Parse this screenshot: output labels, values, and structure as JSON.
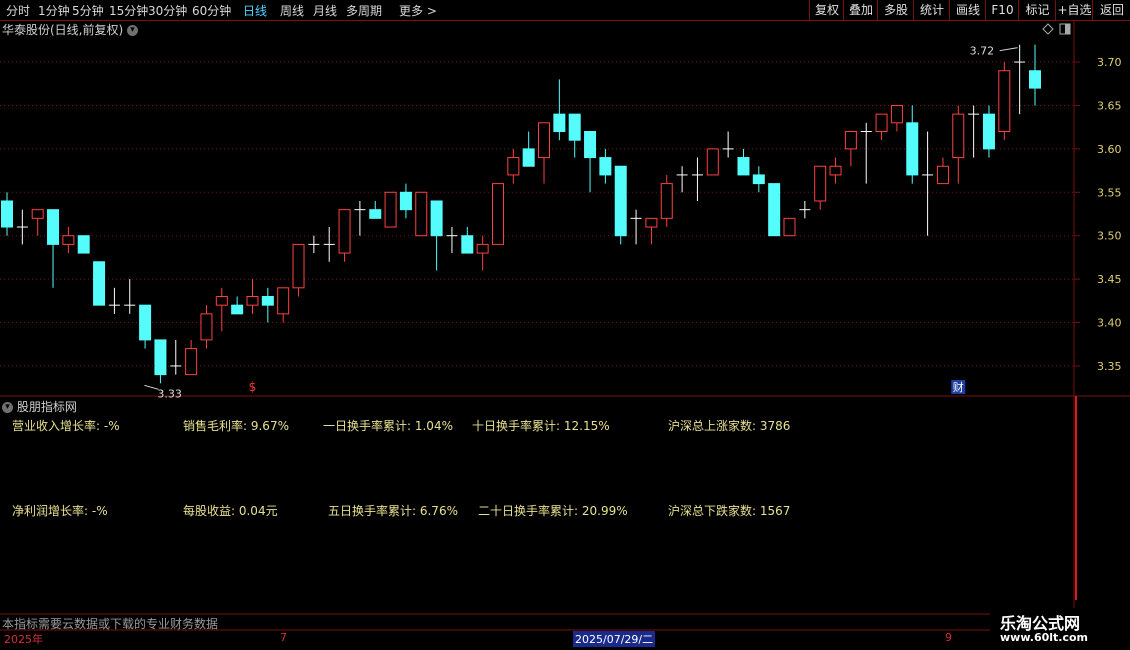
{
  "toolbar": {
    "periods": [
      "分时",
      "1分钟",
      "5分钟",
      "15分钟",
      "30分钟",
      "60分钟",
      "日线",
      "周线",
      "月线",
      "多周期",
      "更多 >"
    ],
    "active_period": "日线",
    "right_buttons": [
      "复权",
      "叠加",
      "多股",
      "统计",
      "画线",
      "F10",
      "标记",
      "+自选",
      "返回"
    ]
  },
  "stock_label": "华泰股份(日线,前复权)",
  "indicator_label": "股朋指标网",
  "indicators": [
    {
      "label": "营业收入增长率: -%"
    },
    {
      "label": "销售毛利率: 9.67%"
    },
    {
      "label": "一日换手率累计: 1.04%"
    },
    {
      "label": "十日换手率累计: 12.15%"
    },
    {
      "label": "沪深总上涨家数: 3786"
    },
    {
      "label": "净利润增长率: -%"
    },
    {
      "label": "每股收益: 0.04元"
    },
    {
      "label": "五日换手率累计: 6.76%"
    },
    {
      "label": "二十日换手率累计: 20.99%"
    },
    {
      "label": "沪深总下跌家数: 1567"
    }
  ],
  "note": "本指标需要云数据或下载的专业财务数据",
  "date_axis": {
    "labels": [
      "2025年",
      "7",
      "9"
    ],
    "selected": "2025/07/29/二"
  },
  "watermark": {
    "title": "乐淘公式网",
    "url": "www.60lt.com"
  },
  "colors": {
    "up": "#ff4040",
    "down": "#54fcfc",
    "doji": "#ffffff",
    "grid": "#7a1010",
    "axis_text": "#e0d070"
  },
  "chart_data": {
    "type": "candlestick",
    "ylim": [
      3.32,
      3.73
    ],
    "yticks": [
      3.35,
      3.4,
      3.45,
      3.5,
      3.55,
      3.6,
      3.65,
      3.7
    ],
    "annotations": [
      {
        "text": "3.72",
        "at_index": 66,
        "kind": "high"
      },
      {
        "text": "3.33",
        "at_index": 10,
        "kind": "low"
      },
      {
        "text": "$",
        "at_index": 16,
        "kind": "marker"
      },
      {
        "text": "财",
        "at_index": 62,
        "kind": "marker"
      }
    ],
    "candles": [
      {
        "o": 3.54,
        "h": 3.55,
        "l": 3.5,
        "c": 3.51
      },
      {
        "o": 3.51,
        "h": 3.53,
        "l": 3.49,
        "c": 3.51
      },
      {
        "o": 3.52,
        "h": 3.53,
        "l": 3.5,
        "c": 3.53
      },
      {
        "o": 3.53,
        "h": 3.53,
        "l": 3.44,
        "c": 3.49
      },
      {
        "o": 3.49,
        "h": 3.51,
        "l": 3.48,
        "c": 3.5
      },
      {
        "o": 3.5,
        "h": 3.5,
        "l": 3.48,
        "c": 3.48
      },
      {
        "o": 3.47,
        "h": 3.47,
        "l": 3.42,
        "c": 3.42
      },
      {
        "o": 3.42,
        "h": 3.44,
        "l": 3.41,
        "c": 3.42
      },
      {
        "o": 3.42,
        "h": 3.45,
        "l": 3.41,
        "c": 3.42
      },
      {
        "o": 3.42,
        "h": 3.42,
        "l": 3.37,
        "c": 3.38
      },
      {
        "o": 3.38,
        "h": 3.38,
        "l": 3.33,
        "c": 3.34
      },
      {
        "o": 3.35,
        "h": 3.38,
        "l": 3.34,
        "c": 3.35
      },
      {
        "o": 3.34,
        "h": 3.38,
        "l": 3.34,
        "c": 3.37
      },
      {
        "o": 3.38,
        "h": 3.42,
        "l": 3.37,
        "c": 3.41
      },
      {
        "o": 3.42,
        "h": 3.44,
        "l": 3.39,
        "c": 3.43
      },
      {
        "o": 3.42,
        "h": 3.43,
        "l": 3.41,
        "c": 3.41
      },
      {
        "o": 3.42,
        "h": 3.45,
        "l": 3.41,
        "c": 3.43
      },
      {
        "o": 3.43,
        "h": 3.44,
        "l": 3.4,
        "c": 3.42
      },
      {
        "o": 3.41,
        "h": 3.44,
        "l": 3.4,
        "c": 3.44
      },
      {
        "o": 3.44,
        "h": 3.49,
        "l": 3.43,
        "c": 3.49
      },
      {
        "o": 3.49,
        "h": 3.5,
        "l": 3.48,
        "c": 3.49
      },
      {
        "o": 3.49,
        "h": 3.51,
        "l": 3.47,
        "c": 3.49
      },
      {
        "o": 3.48,
        "h": 3.53,
        "l": 3.47,
        "c": 3.53
      },
      {
        "o": 3.53,
        "h": 3.54,
        "l": 3.5,
        "c": 3.53
      },
      {
        "o": 3.53,
        "h": 3.54,
        "l": 3.52,
        "c": 3.52
      },
      {
        "o": 3.51,
        "h": 3.55,
        "l": 3.51,
        "c": 3.55
      },
      {
        "o": 3.55,
        "h": 3.56,
        "l": 3.52,
        "c": 3.53
      },
      {
        "o": 3.5,
        "h": 3.55,
        "l": 3.5,
        "c": 3.55
      },
      {
        "o": 3.54,
        "h": 3.54,
        "l": 3.46,
        "c": 3.5
      },
      {
        "o": 3.5,
        "h": 3.51,
        "l": 3.48,
        "c": 3.5
      },
      {
        "o": 3.5,
        "h": 3.51,
        "l": 3.48,
        "c": 3.48
      },
      {
        "o": 3.48,
        "h": 3.5,
        "l": 3.46,
        "c": 3.49
      },
      {
        "o": 3.49,
        "h": 3.56,
        "l": 3.49,
        "c": 3.56
      },
      {
        "o": 3.57,
        "h": 3.6,
        "l": 3.56,
        "c": 3.59
      },
      {
        "o": 3.6,
        "h": 3.62,
        "l": 3.58,
        "c": 3.58
      },
      {
        "o": 3.59,
        "h": 3.63,
        "l": 3.56,
        "c": 3.63
      },
      {
        "o": 3.64,
        "h": 3.68,
        "l": 3.61,
        "c": 3.62
      },
      {
        "o": 3.64,
        "h": 3.64,
        "l": 3.59,
        "c": 3.61
      },
      {
        "o": 3.62,
        "h": 3.62,
        "l": 3.55,
        "c": 3.59
      },
      {
        "o": 3.59,
        "h": 3.6,
        "l": 3.56,
        "c": 3.57
      },
      {
        "o": 3.58,
        "h": 3.58,
        "l": 3.49,
        "c": 3.5
      },
      {
        "o": 3.52,
        "h": 3.53,
        "l": 3.49,
        "c": 3.52
      },
      {
        "o": 3.51,
        "h": 3.52,
        "l": 3.49,
        "c": 3.52
      },
      {
        "o": 3.52,
        "h": 3.57,
        "l": 3.51,
        "c": 3.56
      },
      {
        "o": 3.57,
        "h": 3.58,
        "l": 3.55,
        "c": 3.57
      },
      {
        "o": 3.57,
        "h": 3.59,
        "l": 3.54,
        "c": 3.57
      },
      {
        "o": 3.57,
        "h": 3.6,
        "l": 3.57,
        "c": 3.6
      },
      {
        "o": 3.6,
        "h": 3.62,
        "l": 3.59,
        "c": 3.6
      },
      {
        "o": 3.59,
        "h": 3.6,
        "l": 3.57,
        "c": 3.57
      },
      {
        "o": 3.57,
        "h": 3.58,
        "l": 3.55,
        "c": 3.56
      },
      {
        "o": 3.56,
        "h": 3.56,
        "l": 3.5,
        "c": 3.5
      },
      {
        "o": 3.5,
        "h": 3.52,
        "l": 3.5,
        "c": 3.52
      },
      {
        "o": 3.53,
        "h": 3.54,
        "l": 3.52,
        "c": 3.53
      },
      {
        "o": 3.54,
        "h": 3.58,
        "l": 3.53,
        "c": 3.58
      },
      {
        "o": 3.57,
        "h": 3.59,
        "l": 3.56,
        "c": 3.58
      },
      {
        "o": 3.6,
        "h": 3.62,
        "l": 3.58,
        "c": 3.62
      },
      {
        "o": 3.62,
        "h": 3.63,
        "l": 3.56,
        "c": 3.62
      },
      {
        "o": 3.62,
        "h": 3.64,
        "l": 3.61,
        "c": 3.64
      },
      {
        "o": 3.63,
        "h": 3.65,
        "l": 3.62,
        "c": 3.65
      },
      {
        "o": 3.63,
        "h": 3.65,
        "l": 3.56,
        "c": 3.57
      },
      {
        "o": 3.57,
        "h": 3.62,
        "l": 3.5,
        "c": 3.57
      },
      {
        "o": 3.56,
        "h": 3.59,
        "l": 3.56,
        "c": 3.58
      },
      {
        "o": 3.59,
        "h": 3.65,
        "l": 3.56,
        "c": 3.64
      },
      {
        "o": 3.64,
        "h": 3.65,
        "l": 3.59,
        "c": 3.64
      },
      {
        "o": 3.64,
        "h": 3.65,
        "l": 3.59,
        "c": 3.6
      },
      {
        "o": 3.62,
        "h": 3.7,
        "l": 3.61,
        "c": 3.69
      },
      {
        "o": 3.7,
        "h": 3.72,
        "l": 3.64,
        "c": 3.7
      },
      {
        "o": 3.69,
        "h": 3.72,
        "l": 3.65,
        "c": 3.67
      }
    ]
  }
}
